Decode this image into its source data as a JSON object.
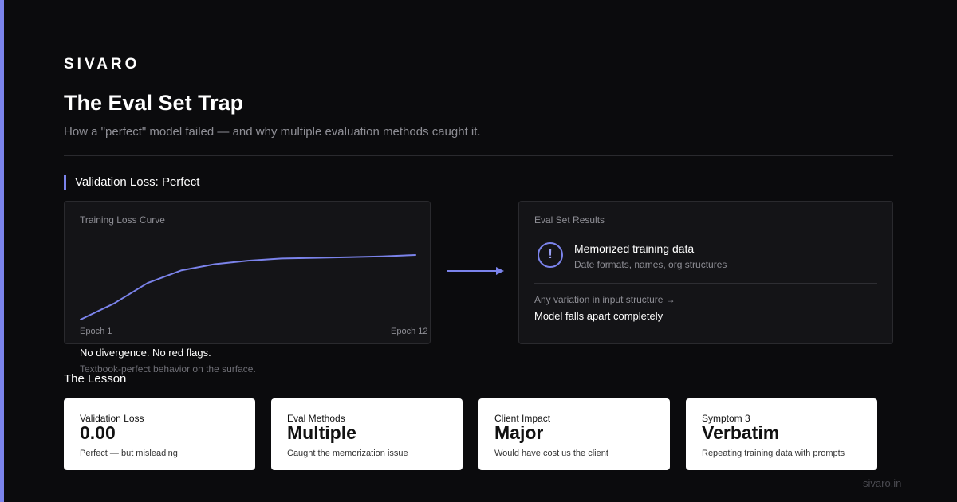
{
  "brand": "SIVARO",
  "title": "The Eval Set Trap",
  "subtitle": "How a \"perfect\" model failed — and why multiple evaluation methods caught it.",
  "section": {
    "title": "Validation Loss: Perfect"
  },
  "loss_panel": {
    "label": "Training Loss Curve",
    "epoch_start": "Epoch 1",
    "epoch_end": "Epoch 12",
    "note_main": "No divergence. No red flags.",
    "note_sub": "Textbook-perfect behavior on the surface."
  },
  "chart_data": {
    "type": "line",
    "title": "Training Loss Curve",
    "x_labels": [
      "Epoch 1",
      "Epoch 12"
    ],
    "x": [
      0,
      1,
      2,
      3,
      4,
      5,
      6,
      7,
      8,
      9,
      10
    ],
    "y": [
      0,
      0.23,
      0.52,
      0.7,
      0.79,
      0.84,
      0.87,
      0.88,
      0.89,
      0.9,
      0.92
    ],
    "ylim": [
      0,
      1
    ],
    "color": "#7b83eb",
    "grid": false
  },
  "eval_panel": {
    "label": "Eval Set Results",
    "icon": "exclamation-icon",
    "icon_glyph": "!",
    "head": "Memorized training data",
    "sub": "Date formats, names, org structures",
    "variation": "Any variation in input structure →",
    "variation_result": "Model falls apart completely"
  },
  "lesson": {
    "title": "The Lesson",
    "cards": [
      {
        "label": "Validation Loss",
        "value": "0.00",
        "desc": "Perfect — but misleading"
      },
      {
        "label": "Eval Methods",
        "value": "Multiple",
        "desc": "Caught the memorization issue"
      },
      {
        "label": "Client Impact",
        "value": "Major",
        "desc": "Would have cost us the client"
      },
      {
        "label": "Symptom 3",
        "value": "Verbatim",
        "desc": "Repeating training data with prompts"
      }
    ]
  },
  "footer": "sivaro.in",
  "colors": {
    "accent": "#7b83eb",
    "background": "#0b0b0d",
    "panel": "#141417"
  }
}
